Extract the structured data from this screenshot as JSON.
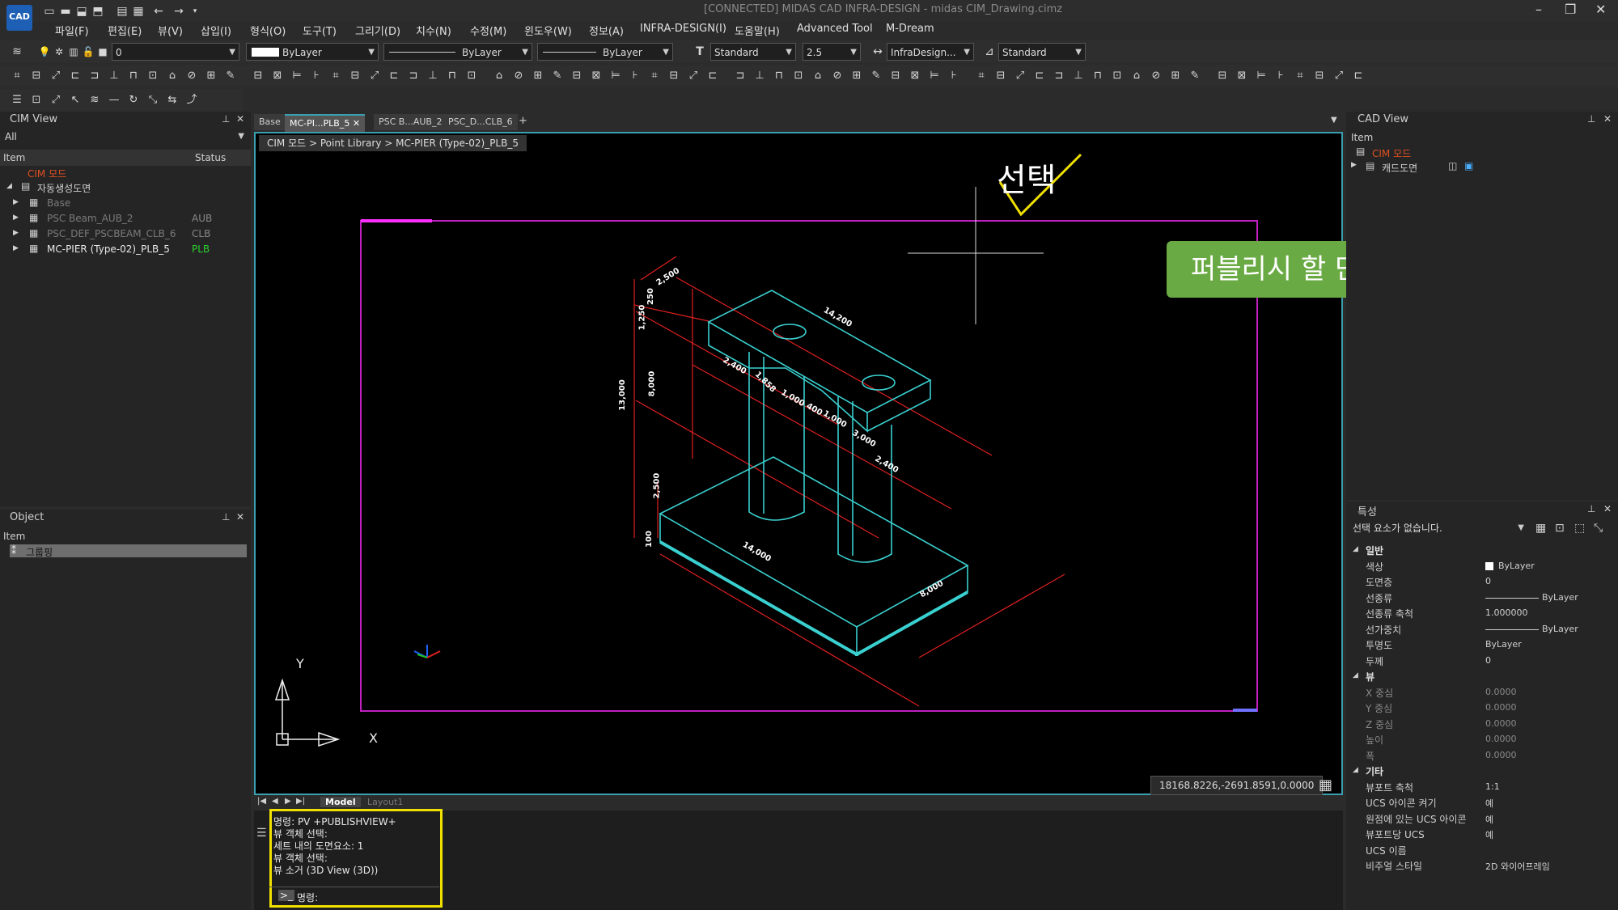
{
  "app": {
    "logo_text": "CAD",
    "window_title": "[CONNECTED] MIDAS CAD INFRA-DESIGN - midas CIM_Drawing.cimz"
  },
  "menus": [
    "파일(F)",
    "편집(E)",
    "뷰(V)",
    "삽입(I)",
    "형식(O)",
    "도구(T)",
    "그리기(D)",
    "치수(N)",
    "수정(M)",
    "윈도우(W)",
    "정보(A)",
    "INFRA-DESIGN(I)",
    "도움말(H)",
    "Advanced Tool",
    "M-Dream"
  ],
  "toolbar": {
    "layer_value": "0",
    "color_value": "ByLayer",
    "linetype_value": "ByLayer",
    "lineweight_value": "ByLayer",
    "textstyle_value": "Standard",
    "textsize_value": "2.5",
    "dimstyle_value": "InfraDesign...",
    "tablestyle_value": "Standard"
  },
  "cim_view": {
    "title": "CIM View",
    "filter": "All",
    "col_item": "Item",
    "col_status": "Status",
    "root_label": "CIM 모드",
    "group_label": "자동생성도면",
    "items": [
      {
        "label": "Base",
        "status": ""
      },
      {
        "label": "PSC Beam_AUB_2",
        "status": "AUB"
      },
      {
        "label": "PSC_DEF_PSCBEAM_CLB_6",
        "status": "CLB"
      },
      {
        "label": "MC-PIER (Type-02)_PLB_5",
        "status": "PLB"
      }
    ]
  },
  "object_panel": {
    "title": "Object",
    "col_item": "Item",
    "row_label": "그룹핑"
  },
  "tabs": [
    {
      "label": "Base"
    },
    {
      "label": "MC-PI...PLB_5"
    },
    {
      "label": "PSC B...AUB_2"
    },
    {
      "label": "PSC_D...CLB_6"
    }
  ],
  "breadcrumb": "CIM 모드 > Point Library > MC-PIER (Type-02)_PLB_5",
  "annotation": {
    "select_label": "선택",
    "callout": "퍼블리시 할 단면 View"
  },
  "drawing": {
    "dims": [
      "2,500",
      "14,200",
      "1,250",
      "250",
      "13,000",
      "8,000",
      "2,400",
      "1,858",
      "1,000",
      "400",
      "1,000",
      "3,000",
      "2,400",
      "2,500",
      "100",
      "14,000",
      "8,000"
    ],
    "axis_x": "X",
    "axis_y": "Y"
  },
  "coords": "18168.8226,-2691.8591,0.0000",
  "layout_tabs": [
    "Model",
    "Layout1"
  ],
  "command": {
    "lines": [
      "명령: PV +PUBLISHVIEW+",
      "뷰 객체 선택:",
      "세트 내의 도면요소: 1",
      "뷰 객체 선택:",
      "뷰 소거 (3D View (3D))"
    ],
    "prompt": "명령:"
  },
  "cad_view": {
    "title": "CAD View",
    "col_item": "Item",
    "root_label": "CIM 모드",
    "child_label": "캐드도면"
  },
  "properties": {
    "title": "특성",
    "selection": "선택 요소가 없습니다.",
    "groups": [
      {
        "name": "일반",
        "rows": [
          {
            "k": "색상",
            "v": "ByLayer"
          },
          {
            "k": "도면층",
            "v": "0"
          },
          {
            "k": "선종류",
            "v": "ByLayer"
          },
          {
            "k": "선종류 축척",
            "v": "1.000000"
          },
          {
            "k": "선가중치",
            "v": "ByLayer"
          },
          {
            "k": "투명도",
            "v": "ByLayer"
          },
          {
            "k": "두께",
            "v": "0"
          }
        ]
      },
      {
        "name": "뷰",
        "rows": [
          {
            "k": "X 중심",
            "v": "0.0000"
          },
          {
            "k": "Y 중심",
            "v": "0.0000"
          },
          {
            "k": "Z 중심",
            "v": "0.0000"
          },
          {
            "k": "높이",
            "v": "0.0000"
          },
          {
            "k": "폭",
            "v": "0.0000"
          }
        ]
      },
      {
        "name": "기타",
        "rows": [
          {
            "k": "뷰포트 축척",
            "v": "1:1"
          },
          {
            "k": "UCS 아이콘 켜기",
            "v": "예"
          },
          {
            "k": "원점에 있는 UCS 아이콘",
            "v": "예"
          },
          {
            "k": "뷰포트당 UCS",
            "v": "예"
          },
          {
            "k": "UCS 이름",
            "v": ""
          },
          {
            "k": "비주얼 스타일",
            "v": "2D 와이어프레임"
          }
        ]
      }
    ]
  },
  "colors": {
    "accent_green": "#6aaa44",
    "highlight_yellow": "#f0e000",
    "model_cyan": "#3ad0d0",
    "dim_red": "#e02020",
    "frame_magenta": "#c020c0"
  }
}
